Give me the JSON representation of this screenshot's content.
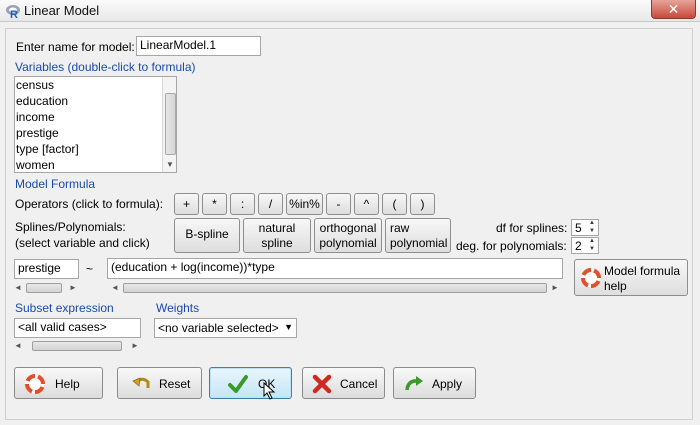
{
  "window": {
    "title": "Linear Model",
    "close_label": "✕"
  },
  "model_name": {
    "label": "Enter name for model:",
    "value": "LinearModel.1"
  },
  "variables": {
    "header": "Variables (double-click to formula)",
    "items": [
      "census",
      "education",
      "income",
      "prestige",
      "type [factor]",
      "women"
    ]
  },
  "model_formula": {
    "header": "Model Formula",
    "operators_label": "Operators (click to formula):",
    "operators": [
      "+",
      "*",
      ":",
      "/",
      "%in%",
      "-",
      "^",
      "(",
      ")"
    ],
    "splines_label_1": "Splines/Polynomials:",
    "splines_label_2": "(select variable and click)",
    "spline_buttons": [
      {
        "line1": "B-spline",
        "line2": ""
      },
      {
        "line1": "natural",
        "line2": "spline"
      },
      {
        "line1": "orthogonal",
        "line2": "polynomial"
      },
      {
        "line1": "raw",
        "line2": "polynomial"
      }
    ],
    "df_label": "df for splines:",
    "df_value": "5",
    "deg_label": "deg. for polynomials:",
    "deg_value": "2",
    "lhs": "prestige",
    "tilde": "~",
    "rhs": "(education + log(income))*type",
    "help_line1": "Model formula",
    "help_line2": "help"
  },
  "subset": {
    "header": "Subset expression",
    "value": "<all valid cases>"
  },
  "weights": {
    "header": "Weights",
    "value": "<no variable selected>"
  },
  "buttons": {
    "help": "Help",
    "reset": "Reset",
    "ok": "OK",
    "cancel": "Cancel",
    "apply": "Apply"
  },
  "colors": {
    "section_header": "#1a4ab0",
    "ok_check": "#3a9a2a",
    "cancel_x": "#d02a20",
    "help_ring": "#e0502a"
  },
  "icons": {
    "title": "r-logo-icon",
    "help": "lifebuoy-icon",
    "reset": "undo-arrow-icon",
    "ok": "checkmark-icon",
    "cancel": "red-x-icon",
    "apply": "green-redo-arrow-icon"
  }
}
